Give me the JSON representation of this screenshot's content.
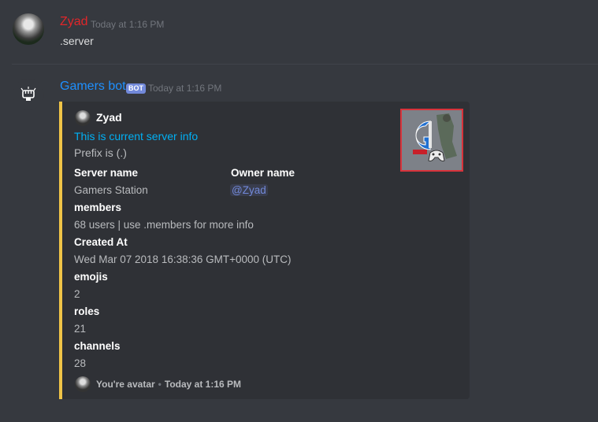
{
  "message1": {
    "username": "Zyad",
    "username_color": "#e0262a",
    "timestamp": "Today at 1:16 PM",
    "content": ".server"
  },
  "message2": {
    "username": "Gamers bot",
    "username_color": "#1e90ff",
    "bot_tag": "BOT",
    "timestamp": "Today at 1:16 PM",
    "avatar_icon": "fist-icon"
  },
  "embed": {
    "accent_color": "#f0c447",
    "author": "Zyad",
    "title": "This is current server info",
    "description": "Prefix is (.)",
    "fields": {
      "server_name": {
        "name": "Server name",
        "value": "Gamers Station"
      },
      "owner_name": {
        "name": "Owner name",
        "value": "@Zyad"
      },
      "members": {
        "name": "members",
        "value": "68 users | use .members for more info"
      },
      "created_at": {
        "name": "Created At",
        "value": "Wed Mar 07 2018 16:38:36 GMT+0000 (UTC)"
      },
      "emojis": {
        "name": "emojis",
        "value": "2"
      },
      "roles": {
        "name": "roles",
        "value": "21"
      },
      "channels": {
        "name": "channels",
        "value": "28"
      }
    },
    "footer": {
      "text": "You're avatar",
      "separator": "•",
      "timestamp": "Today at 1:16 PM"
    },
    "thumbnail_icon": "gamers-station-logo"
  }
}
